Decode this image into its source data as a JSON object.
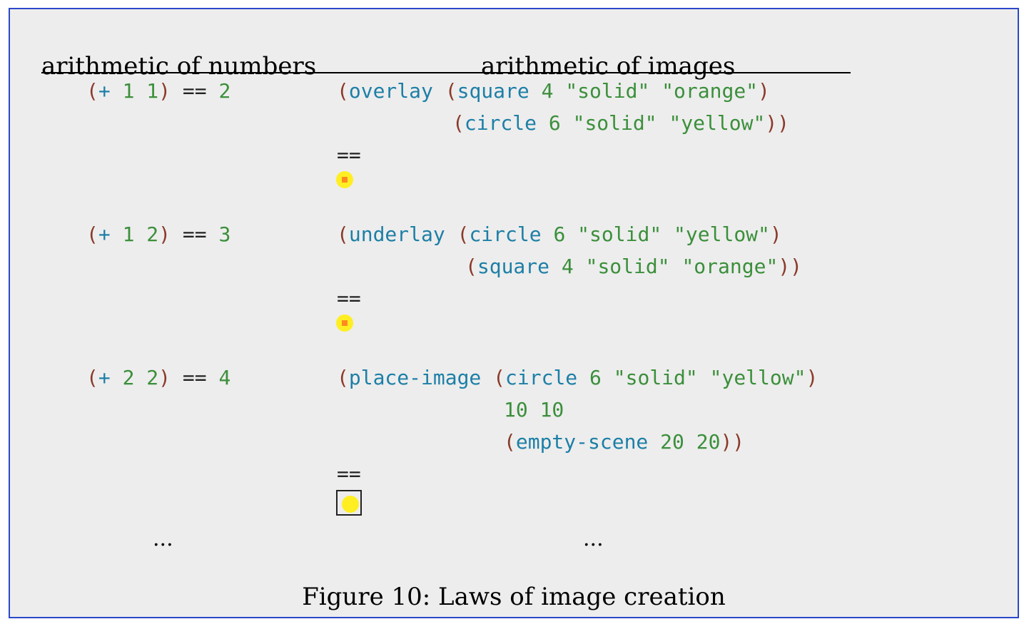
{
  "headers": {
    "numbers": "arithmetic of numbers",
    "images": "arithmetic of images"
  },
  "rows": [
    {
      "number_law": {
        "open": "(",
        "op": "+",
        "a": "1",
        "b": "1",
        "close": ")",
        "eq": "==",
        "result": "2"
      },
      "image_code": {
        "l1": {
          "p1": "(",
          "f1": "overlay",
          "p2": "(",
          "f2": "square",
          "args": "4 \"solid\" \"orange\"",
          "p3": ")"
        },
        "l2": {
          "p1": "(",
          "f1": "circle",
          "args": "6 \"solid\" \"yellow\"",
          "p2": "))"
        }
      },
      "eq": "==",
      "result_image": "yellow-circle-with-orange-square"
    },
    {
      "number_law": {
        "open": "(",
        "op": "+",
        "a": "1",
        "b": "2",
        "close": ")",
        "eq": "==",
        "result": "3"
      },
      "image_code": {
        "l1": {
          "p1": "(",
          "f1": "underlay",
          "p2": "(",
          "f2": "circle",
          "args": "6 \"solid\" \"yellow\"",
          "p3": ")"
        },
        "l2": {
          "p1": "(",
          "f1": "square",
          "args": "4 \"solid\" \"orange\"",
          "p2": "))"
        }
      },
      "eq": "==",
      "result_image": "yellow-circle-with-orange-square"
    },
    {
      "number_law": {
        "open": "(",
        "op": "+",
        "a": "2",
        "b": "2",
        "close": ")",
        "eq": "==",
        "result": "4"
      },
      "image_code": {
        "l1": {
          "p1": "(",
          "f1": "place-image",
          "p2": "(",
          "f2": "circle",
          "args": "6 \"solid\" \"yellow\"",
          "p3": ")"
        },
        "l2": {
          "args": "10 10"
        },
        "l3": {
          "p1": "(",
          "f1": "empty-scene",
          "args": "20 20",
          "p2": "))"
        }
      },
      "eq": "==",
      "result_image": "yellow-circle-in-empty-scene"
    }
  ],
  "ellipsis_left": "...",
  "ellipsis_right": "...",
  "caption": "Figure 10: Laws of image creation",
  "colors": {
    "border": "#2b47c9",
    "background": "#ededed",
    "paren": "#8b3a2a",
    "keyword": "#1d7fa6",
    "literal": "#3b8f3b",
    "yellow": "#ffee22",
    "orange": "#ff8a1e"
  }
}
